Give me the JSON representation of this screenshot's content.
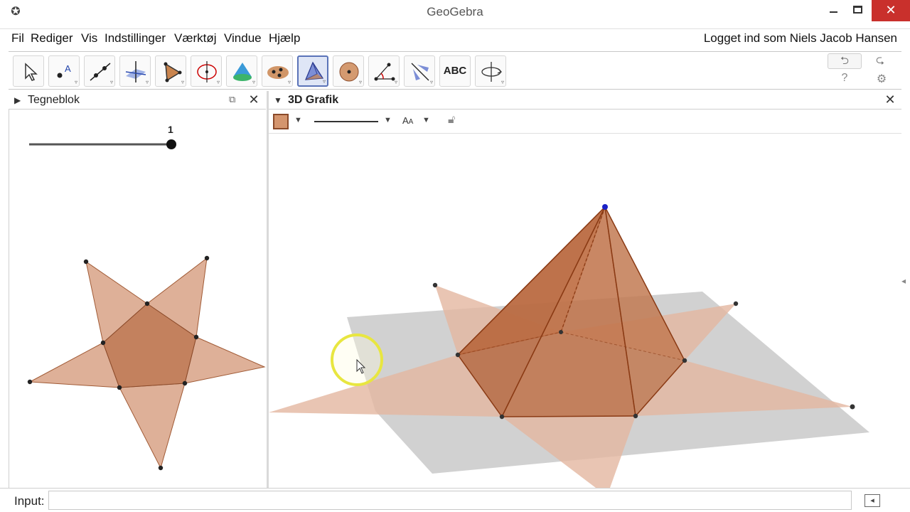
{
  "window": {
    "title": "GeoGebra"
  },
  "menu": {
    "items": [
      "Fil",
      "Rediger",
      "Vis",
      "Indstillinger",
      "Værktøj",
      "Vindue",
      "Hjælp"
    ],
    "login": "Logget ind som Niels Jacob Hansen"
  },
  "toolbar": {
    "tools": [
      {
        "name": "move-tool-icon"
      },
      {
        "name": "point-tool-icon"
      },
      {
        "name": "line-tool-icon"
      },
      {
        "name": "perpendicular-tool-icon"
      },
      {
        "name": "polygon-tool-icon"
      },
      {
        "name": "circle-tool-icon"
      },
      {
        "name": "cone-tool-icon"
      },
      {
        "name": "plane-tool-icon"
      },
      {
        "name": "pyramid-tool-icon"
      },
      {
        "name": "sphere-tool-icon"
      },
      {
        "name": "angle-tool-icon"
      },
      {
        "name": "reflect-tool-icon"
      },
      {
        "name": "text-tool-icon",
        "label": "ABC"
      },
      {
        "name": "rotate-view-tool-icon"
      }
    ],
    "active_tool": "pyramid-tool-icon"
  },
  "graphics_view": {
    "title": "Tegneblok",
    "slider_value": "1"
  },
  "view_3d": {
    "title": "3D Grafik",
    "style_colors": {
      "face": "#d4956e",
      "net": "#e8b79d",
      "edge": "#8a3a14"
    }
  },
  "input": {
    "label": "Input:",
    "value": ""
  }
}
